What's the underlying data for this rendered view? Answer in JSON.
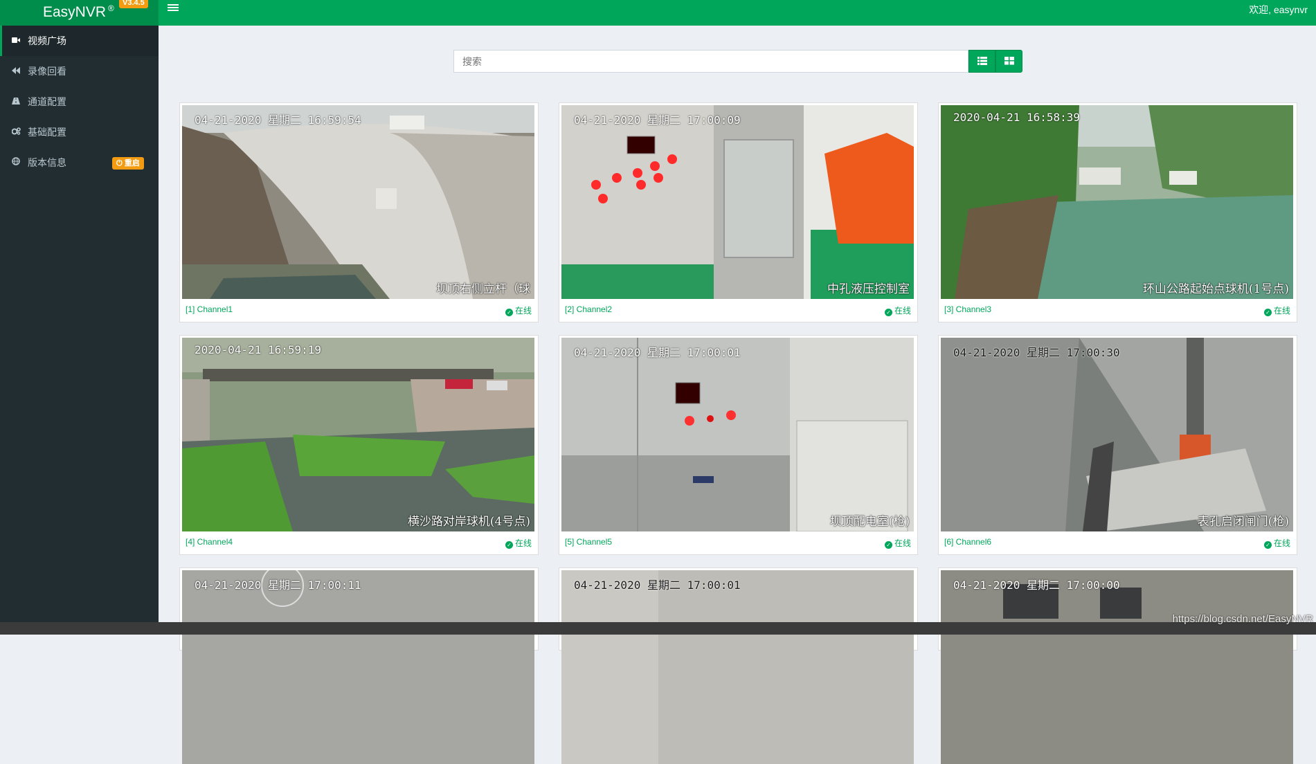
{
  "app": {
    "name": "EasyNVR",
    "reg_mark": "®",
    "version": "V3.4.5"
  },
  "header": {
    "welcome": "欢迎, easynvr"
  },
  "sidebar": {
    "items": [
      {
        "label": "视频广场",
        "icon": "video-camera-icon"
      },
      {
        "label": "录像回看",
        "icon": "backward-icon"
      },
      {
        "label": "通道配置",
        "icon": "road-icon"
      },
      {
        "label": "基础配置",
        "icon": "gears-icon"
      },
      {
        "label": "版本信息",
        "icon": "globe-icon"
      }
    ],
    "restart_badge": "重启"
  },
  "search": {
    "placeholder": "搜索"
  },
  "channels": [
    {
      "id": "[1] Channel1",
      "osd": "04-21-2020 星期二 16:59:54",
      "caption": "坝顶右侧立杆（球",
      "status": "在线"
    },
    {
      "id": "[2] Channel2",
      "osd": "04-21-2020 星期二 17:00:09",
      "caption": "中孔液压控制室",
      "status": "在线"
    },
    {
      "id": "[3] Channel3",
      "osd": "2020-04-21 16:58:39",
      "caption": "环山公路起始点球机(1号点)",
      "status": "在线"
    },
    {
      "id": "[4] Channel4",
      "osd": "2020-04-21 16:59:19",
      "caption": "横沙路对岸球机(4号点)",
      "status": "在线"
    },
    {
      "id": "[5] Channel5",
      "osd": "04-21-2020 星期二 17:00:01",
      "caption": "坝顶配电室(枪)",
      "status": "在线"
    },
    {
      "id": "[6] Channel6",
      "osd": "04-21-2020 星期二 17:00:30",
      "caption": "表孔启闭闸门(枪)",
      "status": "在线"
    },
    {
      "id": "",
      "osd": "04-21-2020 星期二 17:00:11",
      "caption": "",
      "status": ""
    },
    {
      "id": "",
      "osd": "04-21-2020 星期二 17:00:01",
      "caption": "",
      "status": ""
    },
    {
      "id": "",
      "osd": "04-21-2020 星期二 17:00:00",
      "caption": "",
      "status": ""
    }
  ],
  "watermark": "https://blog.csdn.net/EasyNVR",
  "colors": {
    "brand": "#00a65a",
    "sidebar": "#222d32",
    "badge": "#f39c12"
  }
}
